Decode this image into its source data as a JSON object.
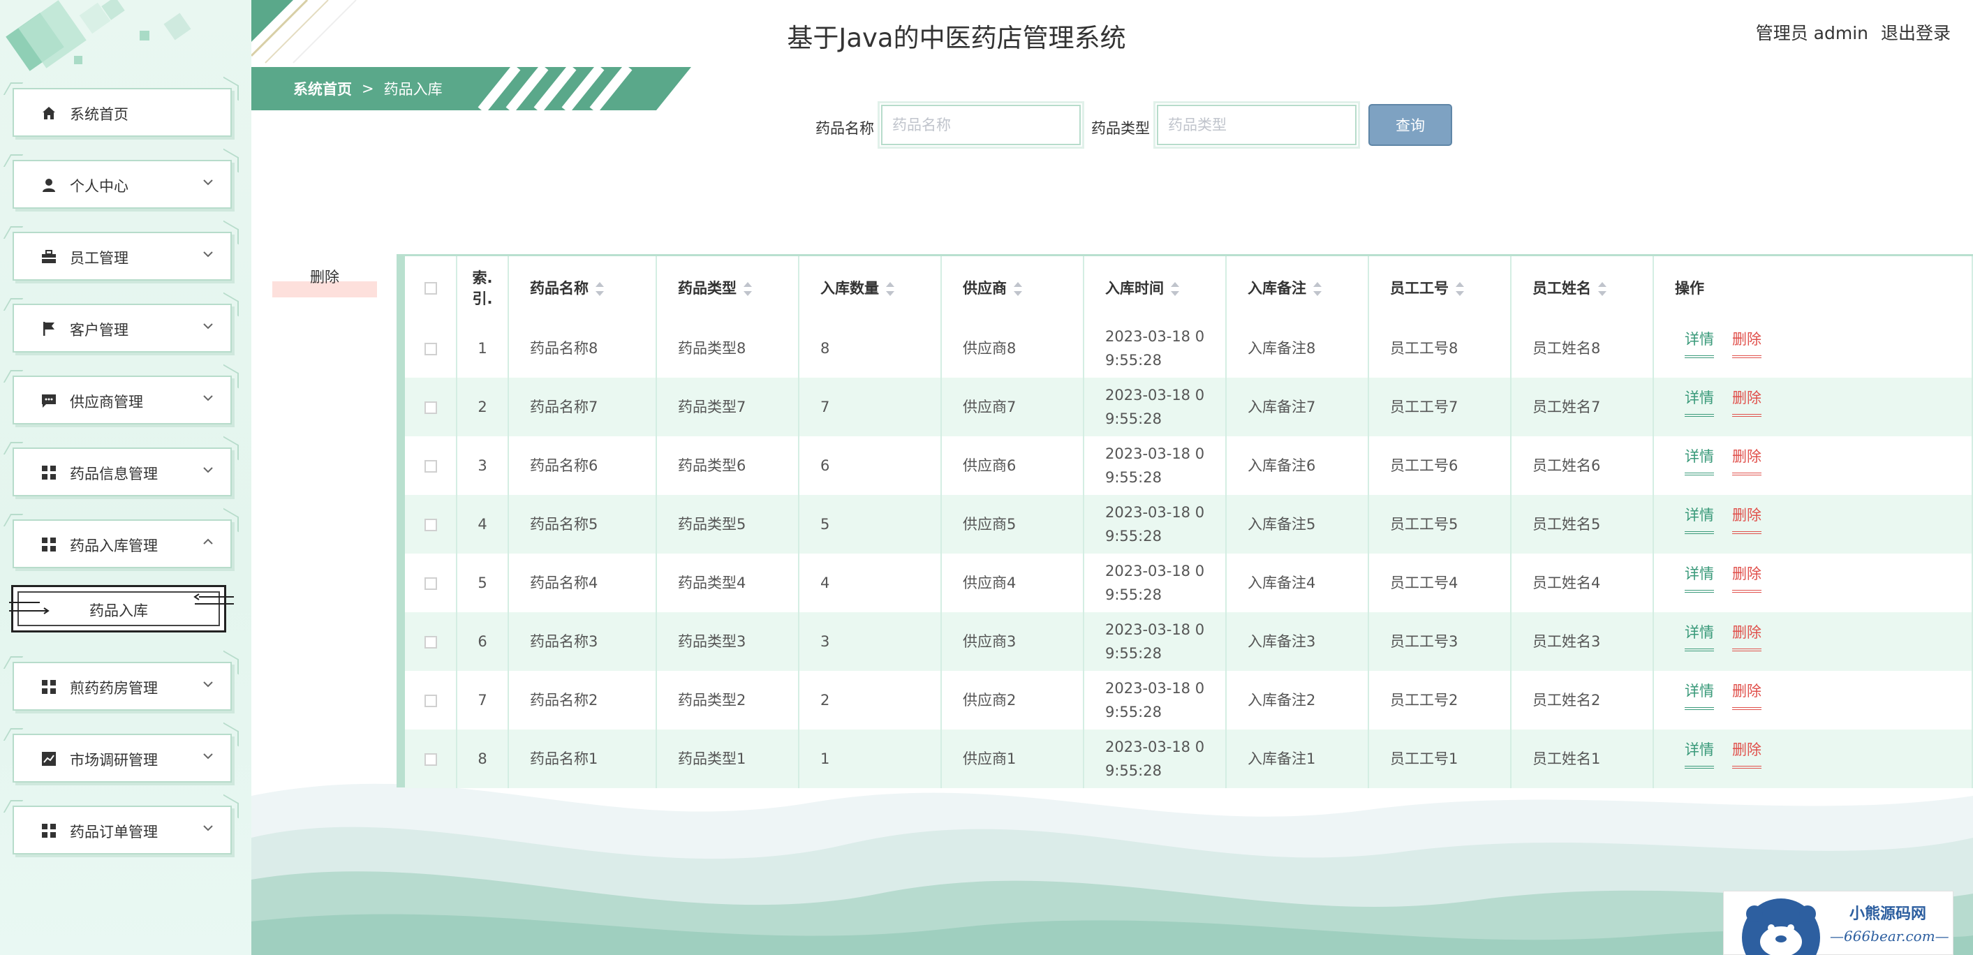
{
  "header": {
    "title": "基于Java的中医药店管理系统",
    "user_role": "管理员 admin",
    "logout": "退出登录"
  },
  "sidebar": {
    "items": [
      {
        "label": "系统首页",
        "icon": "home-icon"
      },
      {
        "label": "个人中心",
        "icon": "user-icon"
      },
      {
        "label": "员工管理",
        "icon": "briefcase-icon"
      },
      {
        "label": "客户管理",
        "icon": "flag-icon"
      },
      {
        "label": "供应商管理",
        "icon": "message-icon"
      },
      {
        "label": "药品信息管理",
        "icon": "grid-icon"
      },
      {
        "label": "药品入库管理",
        "icon": "grid-icon"
      },
      {
        "label": "煎药药房管理",
        "icon": "grid-icon"
      },
      {
        "label": "市场调研管理",
        "icon": "chart-icon"
      },
      {
        "label": "药品订单管理",
        "icon": "grid-icon"
      }
    ],
    "sub_item": "药品入库"
  },
  "breadcrumb": {
    "home": "系统首页",
    "separator": ">",
    "current": "药品入库"
  },
  "search": {
    "name_label": "药品名称",
    "name_placeholder": "药品名称",
    "type_label": "药品类型",
    "type_placeholder": "药品类型",
    "button": "查询"
  },
  "actions": {
    "delete": "删除"
  },
  "table": {
    "columns": [
      "索引",
      "药品名称",
      "药品类型",
      "入库数量",
      "供应商",
      "入库时间",
      "入库备注",
      "员工工号",
      "员工姓名",
      "操作"
    ],
    "index_header_line1": "索.",
    "index_header_line2": "引.",
    "detail_label": "详情",
    "delete_label": "删除",
    "rows": [
      {
        "index": "1",
        "name": "药品名称8",
        "type": "药品类型8",
        "qty": "8",
        "supplier": "供应商8",
        "time1": "2023-03-18 0",
        "time2": "9:55:28",
        "remark": "入库备注8",
        "emp_no": "员工工号8",
        "emp_name": "员工姓名8"
      },
      {
        "index": "2",
        "name": "药品名称7",
        "type": "药品类型7",
        "qty": "7",
        "supplier": "供应商7",
        "time1": "2023-03-18 0",
        "time2": "9:55:28",
        "remark": "入库备注7",
        "emp_no": "员工工号7",
        "emp_name": "员工姓名7"
      },
      {
        "index": "3",
        "name": "药品名称6",
        "type": "药品类型6",
        "qty": "6",
        "supplier": "供应商6",
        "time1": "2023-03-18 0",
        "time2": "9:55:28",
        "remark": "入库备注6",
        "emp_no": "员工工号6",
        "emp_name": "员工姓名6"
      },
      {
        "index": "4",
        "name": "药品名称5",
        "type": "药品类型5",
        "qty": "5",
        "supplier": "供应商5",
        "time1": "2023-03-18 0",
        "time2": "9:55:28",
        "remark": "入库备注5",
        "emp_no": "员工工号5",
        "emp_name": "员工姓名5"
      },
      {
        "index": "5",
        "name": "药品名称4",
        "type": "药品类型4",
        "qty": "4",
        "supplier": "供应商4",
        "time1": "2023-03-18 0",
        "time2": "9:55:28",
        "remark": "入库备注4",
        "emp_no": "员工工号4",
        "emp_name": "员工姓名4"
      },
      {
        "index": "6",
        "name": "药品名称3",
        "type": "药品类型3",
        "qty": "3",
        "supplier": "供应商3",
        "time1": "2023-03-18 0",
        "time2": "9:55:28",
        "remark": "入库备注3",
        "emp_no": "员工工号3",
        "emp_name": "员工姓名3"
      },
      {
        "index": "7",
        "name": "药品名称2",
        "type": "药品类型2",
        "qty": "2",
        "supplier": "供应商2",
        "time1": "2023-03-18 0",
        "time2": "9:55:28",
        "remark": "入库备注2",
        "emp_no": "员工工号2",
        "emp_name": "员工姓名2"
      },
      {
        "index": "8",
        "name": "药品名称1",
        "type": "药品类型1",
        "qty": "1",
        "supplier": "供应商1",
        "time1": "2023-03-18 0",
        "time2": "9:55:28",
        "remark": "入库备注1",
        "emp_no": "员工工号1",
        "emp_name": "员工姓名1"
      }
    ]
  },
  "watermark": {
    "title": "小熊源码网",
    "url": "—666bear.com—"
  },
  "colors": {
    "accent": "#5aa88a",
    "search_button": "#7ea2c2",
    "detail": "#3a9a7a",
    "delete": "#e0504b"
  }
}
